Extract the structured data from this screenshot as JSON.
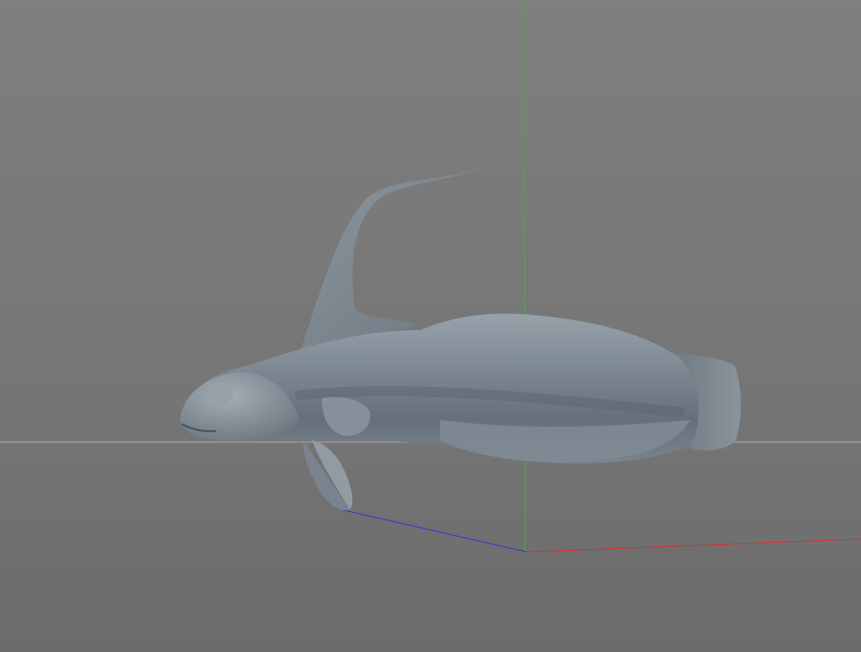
{
  "viewport": {
    "background_top": "#7f7f7f",
    "background_bottom": "#6b6b6b",
    "horizon_color": "#a7a7a7"
  },
  "axes": {
    "x_color": "#c93a3a",
    "y_color": "#3fb03f",
    "z_color": "#3a3ad0"
  },
  "model": {
    "name": "fish-model",
    "base_color": "#7c8791",
    "shadow_color": "#5d666e",
    "highlight_color": "#a3adb5"
  }
}
